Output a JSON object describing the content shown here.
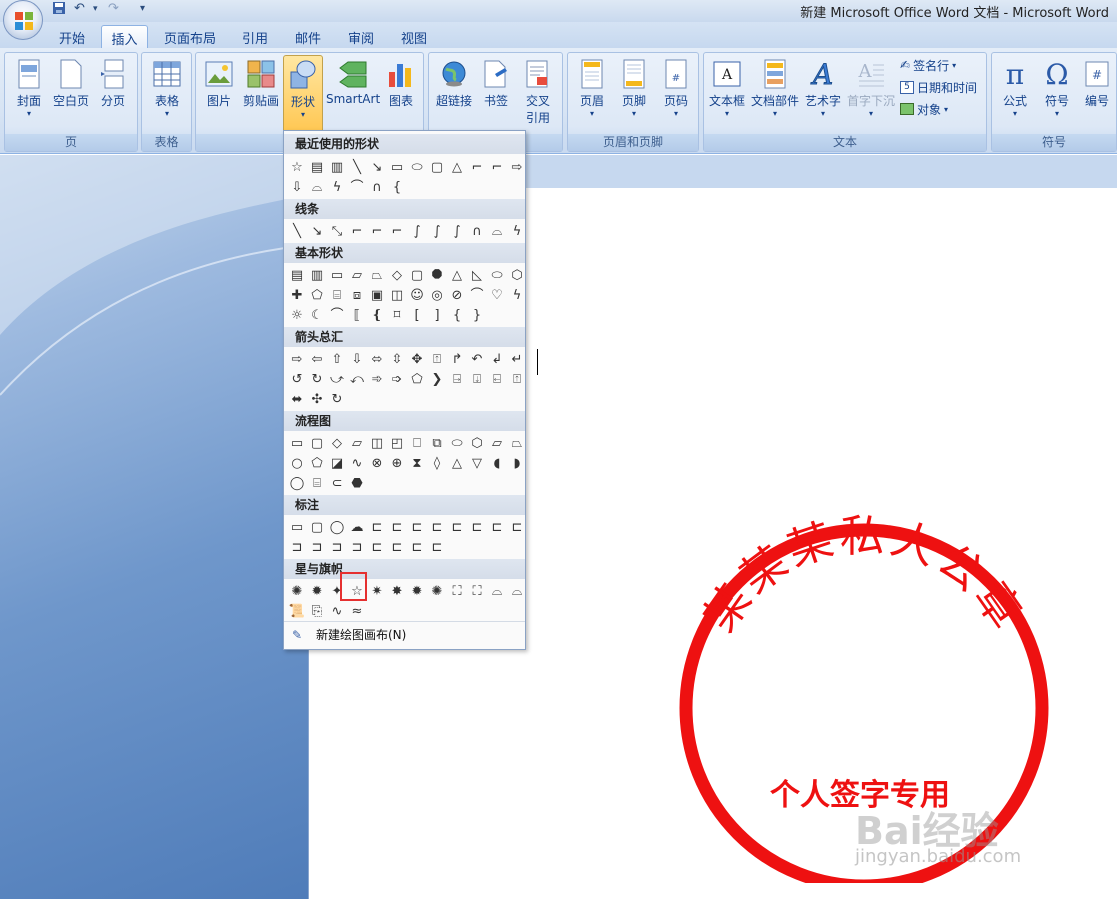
{
  "window": {
    "title": "新建 Microsoft Office Word 文档 - Microsoft Word"
  },
  "qat": {
    "save": "save-icon",
    "undo": "↶",
    "redo": "↷",
    "customize": "▾"
  },
  "tabs": [
    {
      "label": "开始"
    },
    {
      "label": "插入",
      "active": true
    },
    {
      "label": "页面布局"
    },
    {
      "label": "引用"
    },
    {
      "label": "邮件"
    },
    {
      "label": "审阅"
    },
    {
      "label": "视图"
    }
  ],
  "ribbon": {
    "groups": {
      "page": "页",
      "table": "表格",
      "illustrations": "",
      "links": "",
      "header_footer": "页眉和页脚",
      "text": "文本",
      "symbols": "符号"
    },
    "buttons": {
      "cover": "封面",
      "blank_page": "空白页",
      "page_break": "分页",
      "table": "表格",
      "picture": "图片",
      "clipart": "剪贴画",
      "shapes": "形状",
      "smartart": "SmartArt",
      "chart": "图表",
      "hyperlink": "超链接",
      "bookmark": "书签",
      "cross_ref_1": "交叉",
      "cross_ref_2": "引用",
      "header": "页眉",
      "footer": "页脚",
      "page_number": "页码",
      "textbox": "文本框",
      "quick_parts": "文档部件",
      "wordart": "艺术字",
      "dropcap": "首字下沉",
      "signature": "签名行",
      "datetime": "日期和时间",
      "object": "对象",
      "equation": "公式",
      "symbol": "符号",
      "numbering": "编号"
    }
  },
  "shapes_menu": {
    "sections": {
      "recent": "最近使用的形状",
      "lines": "线条",
      "basic": "基本形状",
      "arrows": "箭头总汇",
      "flowchart": "流程图",
      "callouts": "标注",
      "stars": "星与旗帜"
    },
    "new_canvas": "新建绘图画布(N)"
  },
  "colors": {
    "accent": "#15428b",
    "seal_red": "#ee1111",
    "highlight": "#e53030"
  },
  "seal": {
    "arc_text": "某某某私人公章",
    "center_text": "个人签字专用"
  },
  "watermark": {
    "text": "Bai经验",
    "url": "jingyan.baidu.com"
  }
}
